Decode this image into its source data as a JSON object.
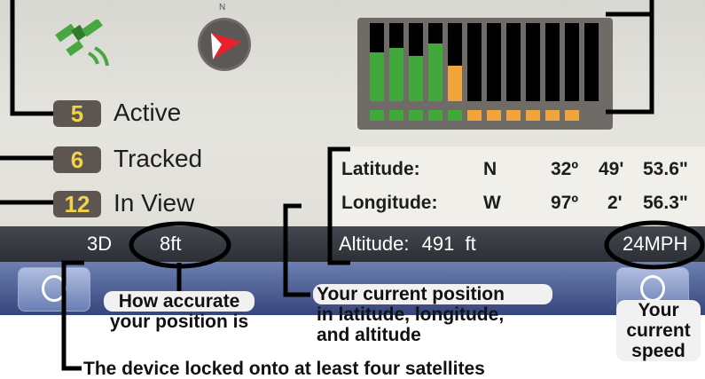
{
  "satellites": {
    "active": {
      "count": "5",
      "label": "Active"
    },
    "tracked": {
      "count": "6",
      "label": "Tracked"
    },
    "in_view": {
      "count": "12",
      "label": "In View"
    }
  },
  "compass": {
    "north_label": "N"
  },
  "signal_bars": {
    "levels": [
      0.62,
      0.68,
      0.58,
      0.74,
      0.46,
      0,
      0,
      0,
      0,
      0,
      0,
      0
    ],
    "colors": [
      "#41a83b",
      "#41a83b",
      "#41a83b",
      "#41a83b",
      "#f0a43a",
      "#000000",
      "#000000",
      "#000000",
      "#000000",
      "#000000",
      "#000000",
      "#000000"
    ],
    "dot_colors": [
      "#41a83b",
      "#41a83b",
      "#41a83b",
      "#41a83b",
      "#41a83b",
      "#f0a43a",
      "#f0a43a",
      "#f0a43a",
      "#f0a43a",
      "#f0a43a",
      "#f0a43a"
    ]
  },
  "position": {
    "latitude": {
      "label": "Latitude:",
      "dir": "N",
      "deg": "32º",
      "min": "49'",
      "sec": "53.6\""
    },
    "longitude": {
      "label": "Longitude:",
      "dir": "W",
      "deg": "97º",
      "min": "2'",
      "sec": "56.3\""
    },
    "altitude": {
      "label": "Altitude:",
      "value": "491",
      "unit": "ft"
    }
  },
  "status": {
    "fix": "3D",
    "accuracy": "8ft",
    "speed": "24MPH"
  },
  "annotations": {
    "accuracy": [
      "How accurate",
      "your position is"
    ],
    "position": [
      "Your current position",
      "in latitude, longitude,",
      "and altitude"
    ],
    "speed": [
      "Your",
      "current",
      "speed"
    ],
    "fix": "The device locked onto at least four satellites"
  },
  "colors": {
    "count_box": "#5d5650",
    "count_text": "#f3d24b",
    "status_bar": "#383a42",
    "bottom_bar": "#4b5b92"
  }
}
